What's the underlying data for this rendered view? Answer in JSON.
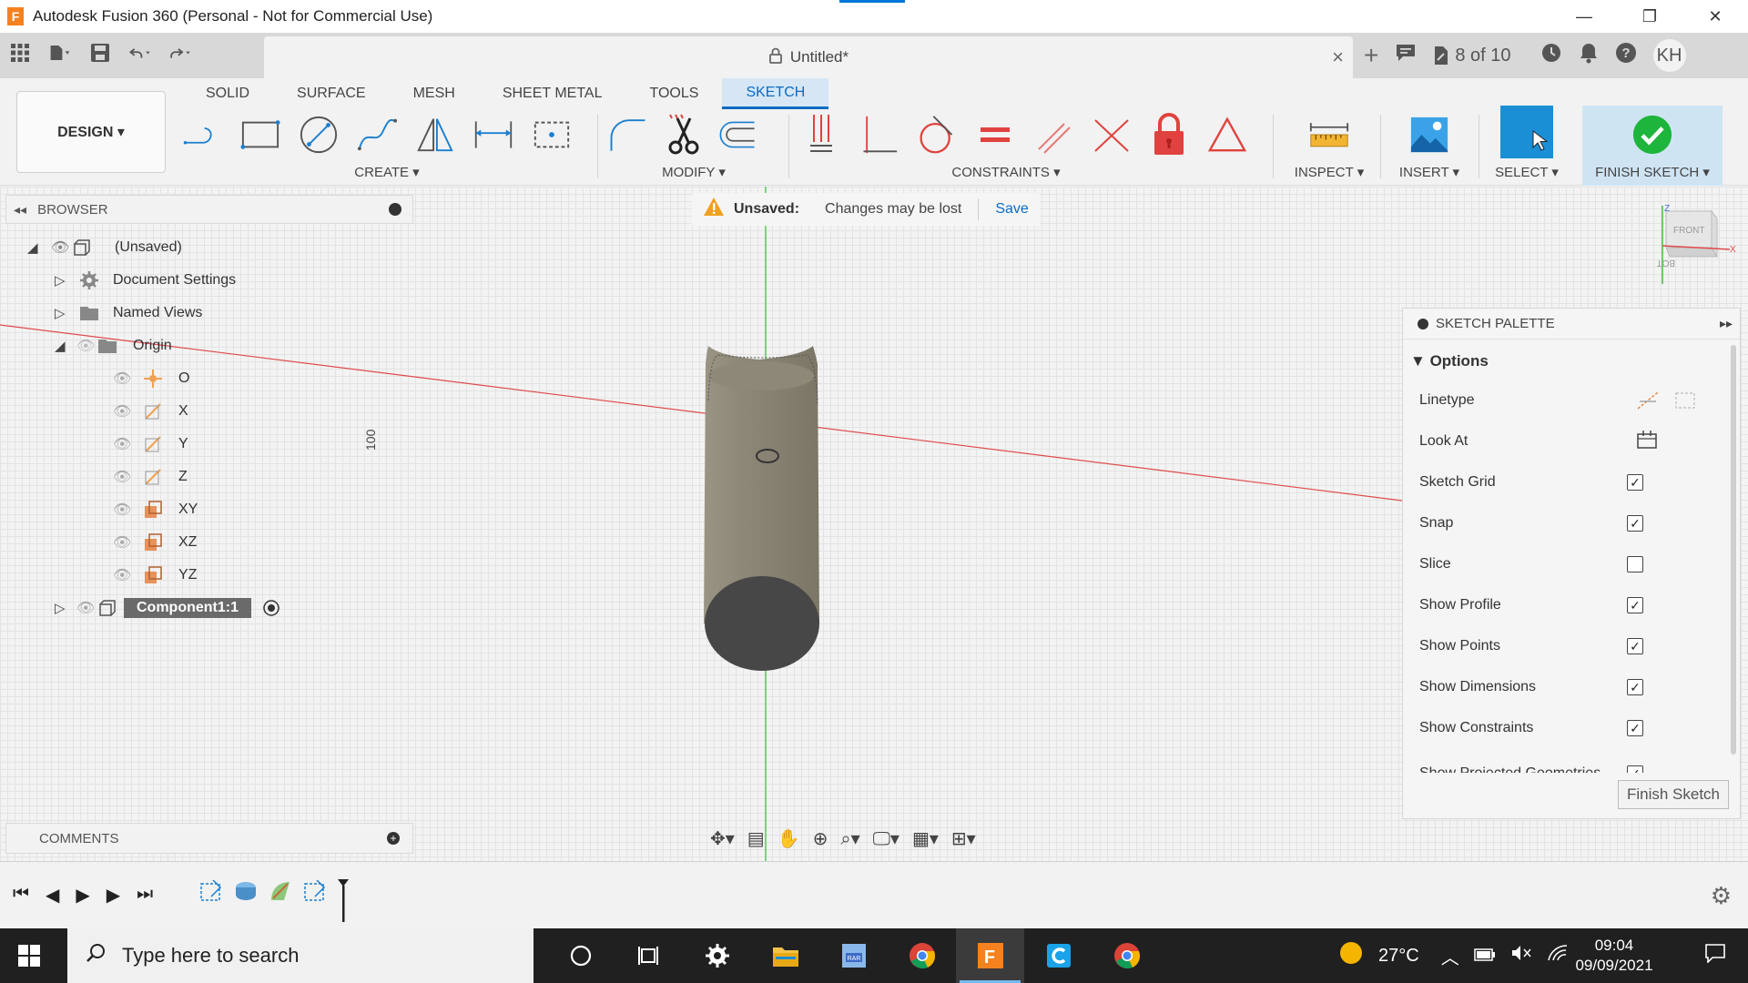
{
  "window": {
    "title": "Autodesk Fusion 360 (Personal - Not for Commercial Use)",
    "logo_letter": "F",
    "min_glyph": "—",
    "max_glyph": "❐",
    "close_glyph": "✕"
  },
  "document": {
    "title": "Untitled*",
    "step_count": "8 of 10",
    "user_initials": "KH"
  },
  "ribbon": {
    "workspace": "DESIGN ▾",
    "tabs": [
      {
        "label": "SOLID"
      },
      {
        "label": "SURFACE"
      },
      {
        "label": "MESH"
      },
      {
        "label": "SHEET METAL"
      },
      {
        "label": "TOOLS"
      },
      {
        "label": "SKETCH"
      }
    ],
    "active_tab": "SKETCH",
    "groups": {
      "create": "CREATE ▾",
      "modify": "MODIFY ▾",
      "constraints": "CONSTRAINTS ▾",
      "inspect": "INSPECT ▾",
      "insert": "INSERT ▾",
      "select": "SELECT ▾",
      "finish": "FINISH SKETCH ▾"
    }
  },
  "banner": {
    "title": "Unsaved:",
    "message": "Changes may be lost",
    "action": "Save"
  },
  "browser": {
    "title": "BROWSER",
    "root": "(Unsaved)",
    "items": [
      {
        "label": "Document Settings"
      },
      {
        "label": "Named Views"
      },
      {
        "label": "Origin"
      },
      {
        "label": "O"
      },
      {
        "label": "X"
      },
      {
        "label": "Y"
      },
      {
        "label": "Z"
      },
      {
        "label": "XY"
      },
      {
        "label": "XZ"
      },
      {
        "label": "YZ"
      },
      {
        "label": "Component1:1"
      }
    ]
  },
  "comments": {
    "title": "COMMENTS"
  },
  "viewport": {
    "dimension_label": "100"
  },
  "viewcube": {
    "front": "FRONT",
    "bottom": "BOTTOM",
    "axis_z": "Z",
    "axis_x": "X"
  },
  "palette": {
    "title": "SKETCH PALETTE",
    "section": "Options",
    "rows": [
      {
        "label": "Linetype",
        "type": "icons"
      },
      {
        "label": "Look At",
        "type": "icon"
      },
      {
        "label": "Sketch Grid",
        "checked": true
      },
      {
        "label": "Snap",
        "checked": true
      },
      {
        "label": "Slice",
        "checked": false
      },
      {
        "label": "Show Profile",
        "checked": true
      },
      {
        "label": "Show Points",
        "checked": true
      },
      {
        "label": "Show Dimensions",
        "checked": true
      },
      {
        "label": "Show Constraints",
        "checked": true
      },
      {
        "label": "Show Projected Geometries",
        "checked": true
      }
    ],
    "finish_button": "Finish Sketch"
  },
  "taskbar": {
    "search_placeholder": "Type here to search",
    "temperature": "27°C",
    "time": "09:04",
    "date": "09/09/2021"
  },
  "colors": {
    "accent": "#0b6cc4",
    "finish_green": "#1db53b",
    "select_blue": "#1a8fd6",
    "constraint_red": "#e0433f",
    "axis_green": "#3fbf3f",
    "axis_red": "#e04a4a"
  }
}
